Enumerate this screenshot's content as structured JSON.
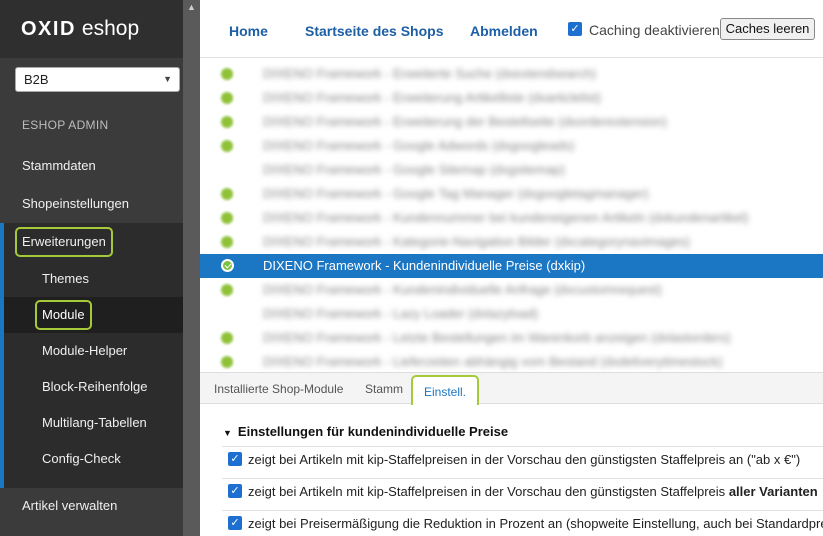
{
  "sidebar": {
    "logo_oxid": "OXID",
    "logo_eshop": "eshop",
    "shop_select": "B2B",
    "admin_label": "ESHOP ADMIN",
    "items": [
      {
        "label": "Stammdaten"
      },
      {
        "label": "Shopeinstellungen"
      },
      {
        "label": "Erweiterungen"
      },
      {
        "label": "Themes"
      },
      {
        "label": "Module"
      },
      {
        "label": "Module-Helper"
      },
      {
        "label": "Block-Reihenfolge"
      },
      {
        "label": "Multilang-Tabellen"
      },
      {
        "label": "Config-Check"
      },
      {
        "label": "Artikel verwalten"
      }
    ]
  },
  "topbar": {
    "home": "Home",
    "startseite": "Startseite des Shops",
    "abmelden": "Abmelden",
    "caching_label": "Caching deaktivieren",
    "caching_checked": true,
    "cache_button": "Caches leeren"
  },
  "modules": [
    {
      "name": "DIXENO Framework - Erweiterte Suche (dxextendsearch)"
    },
    {
      "name": "DIXENO Framework - Erweiterung Artikelliste (dxarticlelist)"
    },
    {
      "name": "DIXENO Framework - Erweiterung der Bestellseite (dxorderextension)"
    },
    {
      "name": "DIXENO Framework - Google Adwords (dxgoogleads)"
    },
    {
      "name": "DIXENO Framework - Google Sitemap (dxgsitemap)"
    },
    {
      "name": "DIXENO Framework - Google Tag Manager (dxgoogletagmanager)"
    },
    {
      "name": "DIXENO Framework - Kundennummer bei kundeneigenen Artikeln (dxkundenartikel)"
    },
    {
      "name": "DIXENO Framework - Kategorie-Navigation Bilder (dxcategorynavimages)"
    },
    {
      "name": "DIXENO Framework - Kundenindividuelle Preise (dxkip)"
    },
    {
      "name": "DIXENO Framework - Kundenindividuelle Anfrage (dxcustomrequest)"
    },
    {
      "name": "DIXENO Framework - Lazy Loader (dxlazyload)"
    },
    {
      "name": "DIXENO Framework - Letzte Bestellungen im Warenkorb anzeigen (dxlastorders)"
    },
    {
      "name": "DIXENO Framework - Lieferzeiten abhängig vom Bestand (dxdeliverytimestock)"
    }
  ],
  "tabs": {
    "installed": "Installierte Shop-Module",
    "stamm": "Stamm",
    "einstell": "Einstell."
  },
  "settings": {
    "heading": "Einstellungen für kundenindividuelle Preise",
    "options": [
      {
        "label": "zeigt bei Artikeln mit kip-Staffelpreisen in der Vorschau den günstigsten Staffelpreis an (\"ab x €\")",
        "checked": true
      },
      {
        "label_pre": "zeigt bei Artikeln mit kip-Staffelpreisen in der Vorschau den günstigsten Staffelpreis",
        "label_bold": "aller Varianten",
        "checked": true
      },
      {
        "label": "zeigt bei Preisermäßigung die Reduktion in Prozent an (shopweite Einstellung, auch bei Standardpreisen)",
        "checked": true
      }
    ]
  }
}
